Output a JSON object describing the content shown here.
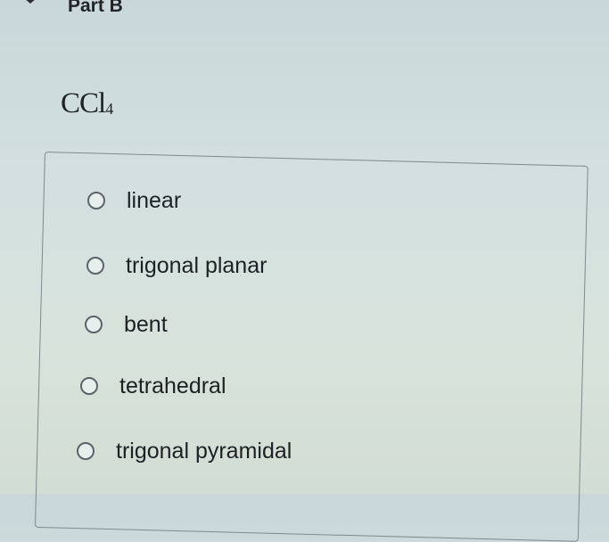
{
  "part": {
    "title": "Part B"
  },
  "question": {
    "formula_main": "CCl",
    "formula_subscript": "4"
  },
  "options": [
    {
      "label": "linear",
      "selected": false
    },
    {
      "label": "trigonal planar",
      "selected": false
    },
    {
      "label": "bent",
      "selected": false
    },
    {
      "label": "tetrahedral",
      "selected": false
    },
    {
      "label": "trigonal pyramidal",
      "selected": false
    }
  ],
  "icons": {
    "collapse": "chevron-down-icon",
    "radio": "radio-button-icon"
  }
}
